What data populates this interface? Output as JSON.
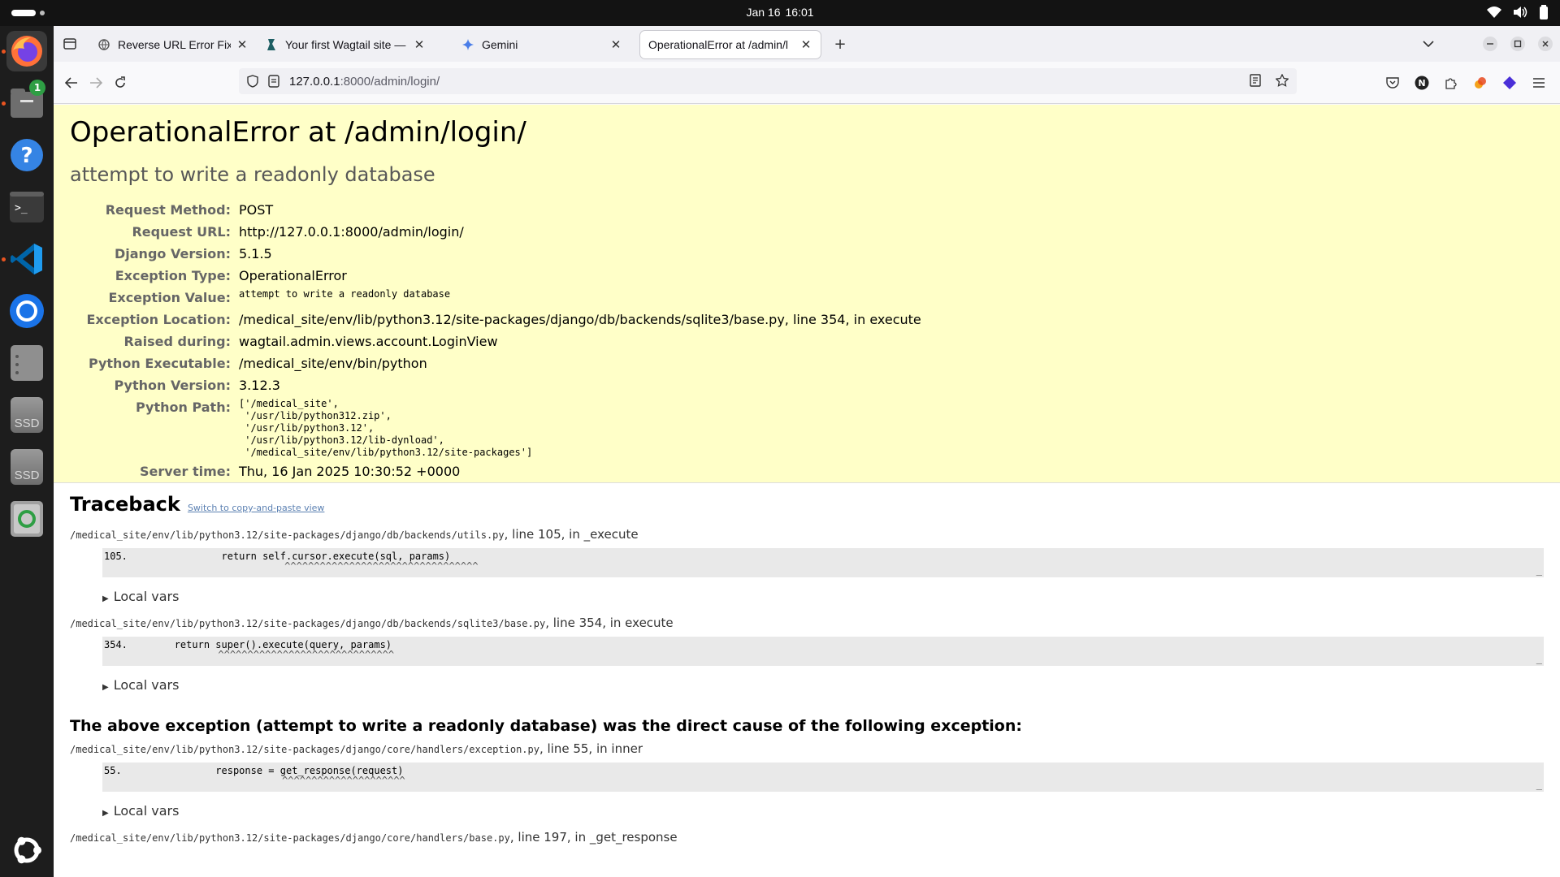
{
  "system": {
    "date": "Jan 16",
    "time": "16:01"
  },
  "dock": {
    "items": [
      {
        "name": "firefox-icon"
      },
      {
        "name": "files-icon",
        "badge": "1"
      },
      {
        "name": "help-icon"
      },
      {
        "name": "terminal-icon"
      },
      {
        "name": "vscode-icon"
      },
      {
        "name": "chromium-icon"
      },
      {
        "name": "remote-desktop-icon"
      },
      {
        "name": "drive-icon",
        "label": "SSD"
      },
      {
        "name": "drive-icon",
        "label": "SSD"
      },
      {
        "name": "trash-icon"
      },
      {
        "name": "ubuntu-apps-icon"
      }
    ]
  },
  "browser": {
    "tabs": [
      {
        "title": "Reverse URL Error Fix",
        "active": false
      },
      {
        "title": "Your first Wagtail site — W",
        "active": false
      },
      {
        "title": "Gemini",
        "active": false
      },
      {
        "title": "OperationalError at /admin/l",
        "active": true
      }
    ],
    "url_host": "127.0.0.1",
    "url_rest": ":8000/admin/login/"
  },
  "error": {
    "title": "OperationalError at /admin/login/",
    "message": "attempt to write a readonly database",
    "meta": [
      {
        "label": "Request Method:",
        "value": "POST"
      },
      {
        "label": "Request URL:",
        "value": "http://127.0.0.1:8000/admin/login/"
      },
      {
        "label": "Django Version:",
        "value": "5.1.5"
      },
      {
        "label": "Exception Type:",
        "value": "OperationalError"
      },
      {
        "label": "Exception Value:",
        "value": "attempt to write a readonly database"
      },
      {
        "label": "Exception Location:",
        "value": "/medical_site/env/lib/python3.12/site-packages/django/db/backends/sqlite3/base.py, line 354, in execute"
      },
      {
        "label": "Raised during:",
        "value": "wagtail.admin.views.account.LoginView"
      },
      {
        "label": "Python Executable:",
        "value": "/medical_site/env/bin/python"
      },
      {
        "label": "Python Version:",
        "value": "3.12.3"
      },
      {
        "label": "Python Path:",
        "value": "['/medical_site',\n '/usr/lib/python312.zip',\n '/usr/lib/python3.12',\n '/usr/lib/python3.12/lib-dynload',\n '/medical_site/env/lib/python3.12/site-packages']"
      },
      {
        "label": "Server time:",
        "value": "Thu, 16 Jan 2025 10:30:52 +0000"
      }
    ]
  },
  "traceback": {
    "heading": "Traceback",
    "switch_link": "Switch to copy-and-paste view",
    "local_vars": "Local vars",
    "cause_text": "The above exception (attempt to write a readonly database) was the direct cause of the following exception:",
    "frames": [
      {
        "file": "/medical_site/env/lib/python3.12/site-packages/django/db/backends/utils.py",
        "loc": ", line 105, in _execute",
        "lineno": "105.",
        "code": "                return self.cursor.execute(sql, params)",
        "carets": "                       ^^^^^^^^^^^^^^^^^^^^^^^^^^^^^^^^^"
      },
      {
        "file": "/medical_site/env/lib/python3.12/site-packages/django/db/backends/sqlite3/base.py",
        "loc": ", line 354, in execute",
        "lineno": "354.",
        "code": "        return super().execute(query, params)",
        "carets": "               ^^^^^^^^^^^^^^^^^^^^^^^^^^^^^^"
      },
      {
        "file": "/medical_site/env/lib/python3.12/site-packages/django/core/handlers/exception.py",
        "loc": ", line 55, in inner",
        "lineno": "55.",
        "code": "                response = get_response(request)",
        "carets": "                           ^^^^^^^^^^^^^^^^^^^^^"
      },
      {
        "file": "/medical_site/env/lib/python3.12/site-packages/django/core/handlers/base.py",
        "loc": ", line 197, in _get_response"
      }
    ]
  }
}
